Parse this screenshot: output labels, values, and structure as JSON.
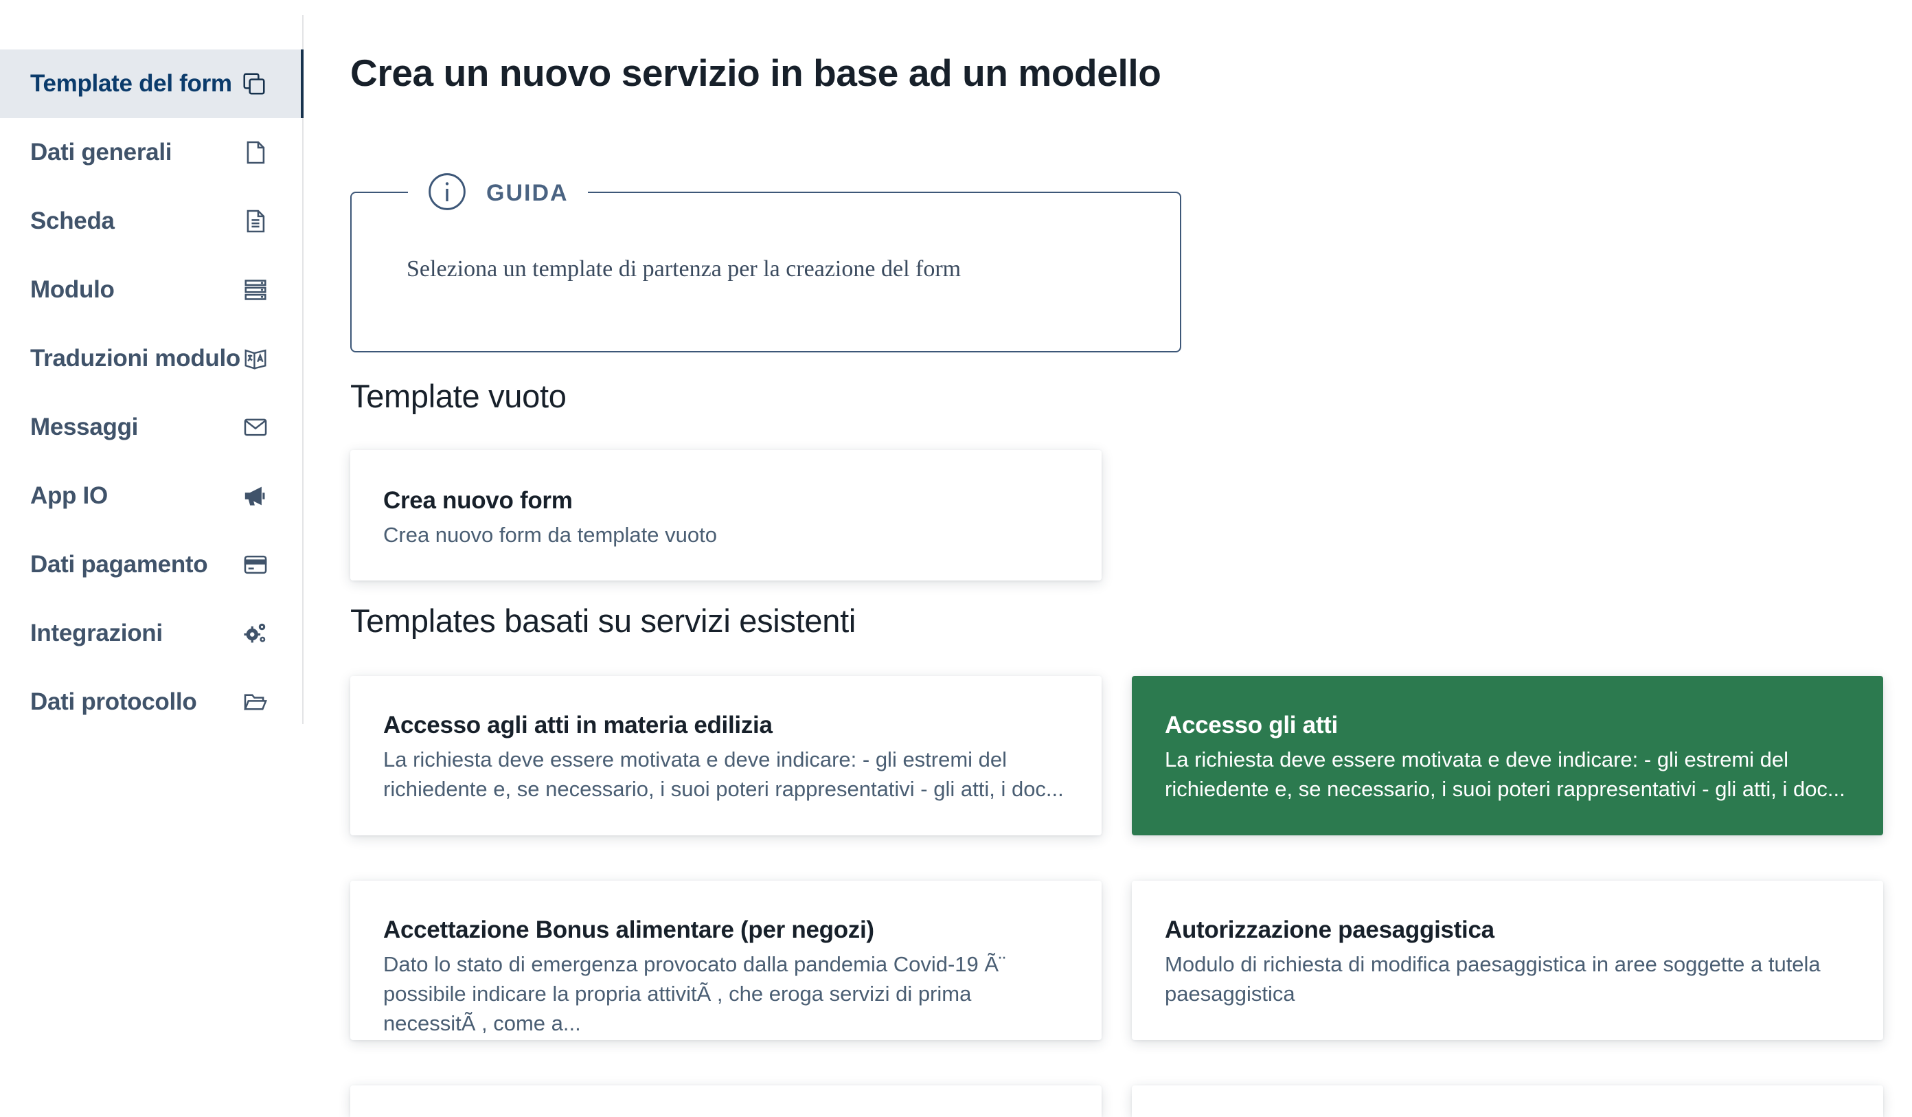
{
  "sidebar": {
    "items": [
      {
        "label": "Template del form",
        "icon": "copy-icon",
        "active": true
      },
      {
        "label": "Dati generali",
        "icon": "file-icon"
      },
      {
        "label": "Scheda",
        "icon": "file-text-icon"
      },
      {
        "label": "Modulo",
        "icon": "server-icon"
      },
      {
        "label": "Traduzioni modulo",
        "icon": "translate-icon"
      },
      {
        "label": "Messaggi",
        "icon": "envelope-icon"
      },
      {
        "label": "App IO",
        "icon": "megaphone-icon"
      },
      {
        "label": "Dati pagamento",
        "icon": "credit-card-icon"
      },
      {
        "label": "Integrazioni",
        "icon": "gears-icon"
      },
      {
        "label": "Dati protocollo",
        "icon": "folder-open-icon"
      }
    ]
  },
  "main": {
    "title": "Crea un nuovo servizio in base ad un modello",
    "guide": {
      "title": "GUIDA",
      "text": "Seleziona un template di partenza per la creazione del form"
    },
    "empty_section": {
      "title": "Template vuoto",
      "card": {
        "title": "Crea nuovo form",
        "description": "Crea nuovo form da template vuoto"
      }
    },
    "existing_section": {
      "title": "Templates basati su servizi esistenti",
      "cards": [
        {
          "title": "Accesso agli atti in materia edilizia",
          "description": "La richiesta deve essere motivata e deve indicare: - gli estremi del richiedente e, se necessario, i suoi poteri rappresentativi - gli atti, i doc..."
        },
        {
          "title": "Accesso gli atti",
          "description": "La richiesta deve essere motivata e deve indicare: - gli estremi del richiedente e, se necessario, i suoi poteri rappresentativi - gli atti, i doc...",
          "selected": true
        },
        {
          "title": "Accettazione Bonus alimentare (per negozi)",
          "description": "Dato lo stato di emergenza provocato dalla pandemia Covid-19 Ã¨ possibile indicare la propria attivitÃ , che eroga servizi di prima necessitÃ , come a..."
        },
        {
          "title": "Autorizzazione paesaggistica",
          "description": "Modulo di richiesta di modifica paesaggistica in aree soggette a tutela paesaggistica"
        }
      ]
    }
  },
  "colors": {
    "selected_card": "#2c7a4f",
    "active_nav_bg": "#e5e9ee",
    "active_nav_border": "#17324d",
    "nav_text": "#40536a",
    "guide_border": "#3d5778"
  }
}
